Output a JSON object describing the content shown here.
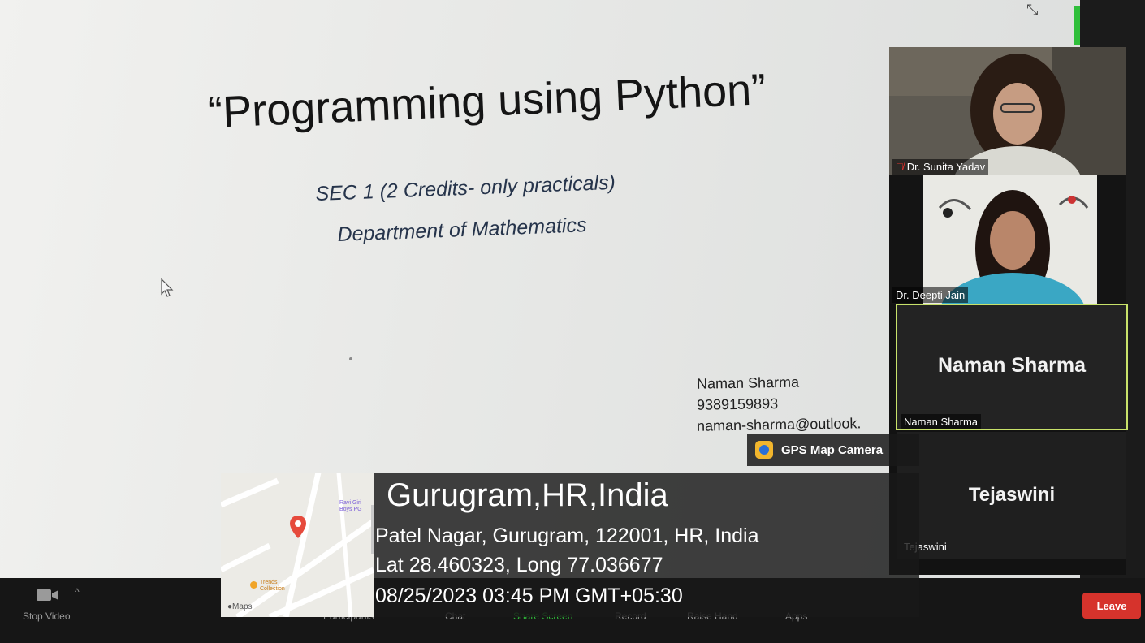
{
  "slide": {
    "title": "“Programming using Python”",
    "subtitle1": "SEC 1  (2 Credits- only practicals)",
    "subtitle2": "Department of Mathematics",
    "contact_name": "Naman Sharma",
    "contact_phone": "9389159893",
    "contact_email": "naman-sharma@outlook."
  },
  "participants": [
    {
      "name": "Dr. Sunita Yadav",
      "muted": true
    },
    {
      "name": "Dr. Deepti Jain"
    },
    {
      "name": "Naman Sharma",
      "display": "Naman Sharma",
      "active_speaker": true
    },
    {
      "name": "Tejaswini",
      "display": "Tejaswini"
    }
  ],
  "toolbar": {
    "stop_video": "Stop Video",
    "participants": "Participants",
    "chat": "Chat",
    "share_screen": "Share Screen",
    "record": "Record",
    "raise_hand": "Raise Hand",
    "apps": "Apps",
    "leave": "Leave"
  },
  "gps": {
    "app_name": "GPS Map Camera",
    "city": "Gurugram,HR,India",
    "address": "Patel Nagar, Gurugram, 122001, HR, India",
    "coords": "Lat 28.460323, Long 77.036677",
    "datetime": "08/25/2023 03:45 PM GMT+05:30",
    "map_label_1": "Ravi Giri Boys PG",
    "map_label_2": "Trends Collection",
    "map_brand": "Maps"
  },
  "colors": {
    "leave": "#d6332c",
    "share_screen": "#2fbf3a",
    "active_speaker_border": "#c8e26a",
    "map_pin": "#e64a3c"
  }
}
